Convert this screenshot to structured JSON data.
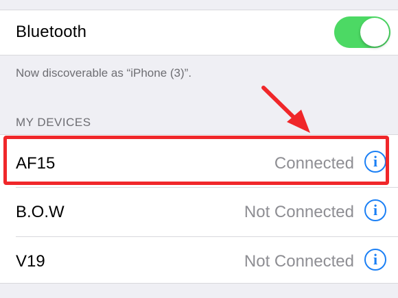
{
  "bluetooth": {
    "label": "Bluetooth",
    "enabled": true
  },
  "discoverable_text": "Now discoverable as “iPhone (3)”.",
  "my_devices": {
    "header": "MY DEVICES",
    "devices": [
      {
        "name": "AF15",
        "status": "Connected",
        "icon": "info-icon"
      },
      {
        "name": "B.O.W",
        "status": "Not Connected",
        "icon": "info-icon"
      },
      {
        "name": "V19",
        "status": "Not Connected",
        "icon": "info-icon"
      }
    ]
  },
  "colors": {
    "toggle_on": "#4cd964",
    "accent_blue": "#1a7ff5",
    "annotation_red": "#f0272a"
  }
}
